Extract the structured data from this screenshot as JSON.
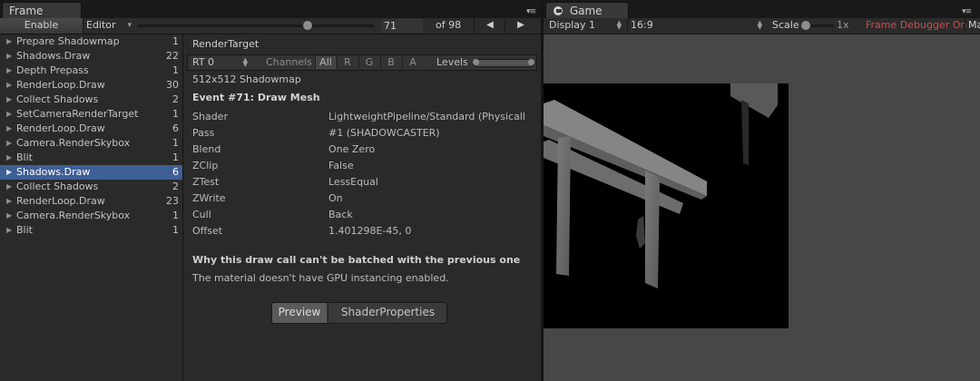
{
  "frame_debug": {
    "tab_title": "Frame Debug",
    "enable_label": "Enable",
    "target_dropdown": "Editor",
    "current_event": "71",
    "total_events": "of 98",
    "slider_fraction": 0.72
  },
  "events": [
    {
      "label": "Prepare Shadowmap",
      "count": "1"
    },
    {
      "label": "Shadows.Draw",
      "count": "22"
    },
    {
      "label": "Depth Prepass",
      "count": "1"
    },
    {
      "label": "RenderLoop.Draw",
      "count": "30"
    },
    {
      "label": "Collect Shadows",
      "count": "2"
    },
    {
      "label": "SetCameraRenderTarget",
      "count": "1"
    },
    {
      "label": "RenderLoop.Draw",
      "count": "6"
    },
    {
      "label": "Camera.RenderSkybox",
      "count": "1"
    },
    {
      "label": "Blit",
      "count": "1"
    },
    {
      "label": "Shadows.Draw",
      "count": "6",
      "selected": true
    },
    {
      "label": "Collect Shadows",
      "count": "2"
    },
    {
      "label": "RenderLoop.Draw",
      "count": "23"
    },
    {
      "label": "Camera.RenderSkybox",
      "count": "1"
    },
    {
      "label": "Blit",
      "count": "1"
    }
  ],
  "detail": {
    "render_target_heading": "RenderTarget",
    "rt_dropdown": "RT 0",
    "channels_label": "Channels",
    "channels": [
      "All",
      "R",
      "G",
      "B",
      "A"
    ],
    "levels_label": "Levels",
    "rt_info": "512x512 Shadowmap",
    "event_title": "Event #71: Draw Mesh",
    "properties": [
      {
        "key": "Shader",
        "value": "LightweightPipeline/Standard (Physicall"
      },
      {
        "key": "Pass",
        "value": "#1 (SHADOWCASTER)"
      },
      {
        "key": "Blend",
        "value": "One Zero"
      },
      {
        "key": "ZClip",
        "value": "False"
      },
      {
        "key": "ZTest",
        "value": "LessEqual"
      },
      {
        "key": "ZWrite",
        "value": "On"
      },
      {
        "key": "Cull",
        "value": "Back"
      },
      {
        "key": "Offset",
        "value": "1.401298E-45, 0"
      }
    ],
    "batch_heading": "Why this draw call can't be batched with the previous one",
    "batch_reason": "The material doesn't have GPU instancing enabled.",
    "tabs": [
      {
        "label": "Preview",
        "active": true
      },
      {
        "label": "ShaderProperties",
        "active": false
      }
    ]
  },
  "game": {
    "tab_title": "Game",
    "display_dropdown": "Display 1",
    "aspect_dropdown": "16:9",
    "scale_label": "Scale",
    "scale_value": "1x",
    "status": "Frame Debugger On",
    "truncated_button": "Ma",
    "status_color": "#d04a4a"
  }
}
